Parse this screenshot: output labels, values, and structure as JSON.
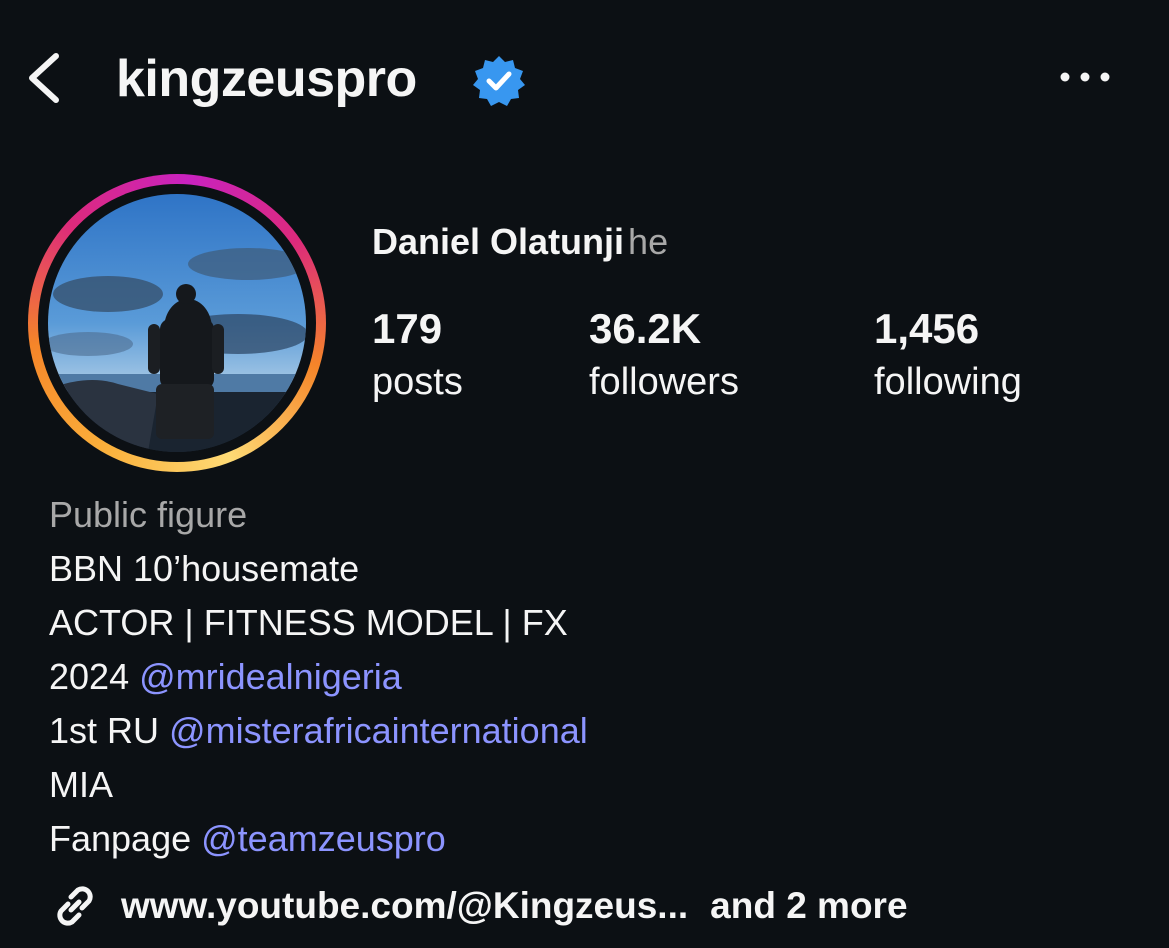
{
  "header": {
    "back_icon": "chevron-left-icon",
    "username": "kingzeuspro",
    "verified_icon": "verified-badge-icon",
    "more_icon": "more-horizontal-icon",
    "colors": {
      "verified": "#3897f0"
    }
  },
  "profile": {
    "avatar_icon": "profile-photo",
    "display_name": "Daniel Olatunji",
    "pronoun": "he",
    "stats": [
      {
        "value": "179",
        "label": "posts"
      },
      {
        "value": "36.2K",
        "label": "followers"
      },
      {
        "value": "1,456",
        "label": "following"
      }
    ]
  },
  "bio": {
    "category": "Public figure",
    "line1": "BBN 10’housemate",
    "line2": "ACTOR | FITNESS MODEL | FX",
    "line3_prefix": "2024 ",
    "line3_mention": "@mridealnigeria",
    "line4_prefix": "1st RU ",
    "line4_mention": "@misterafricainternational",
    "line5": "MIA",
    "line6_prefix": "Fanpage ",
    "line6_mention": "@teamzeuspro",
    "colors": {
      "mention": "#8c94ff",
      "category": "#a8a8a8"
    }
  },
  "links": {
    "icon": "link-icon",
    "url_text": "www.youtube.com/@Kingzeus...",
    "more_text": "and 2 more"
  }
}
